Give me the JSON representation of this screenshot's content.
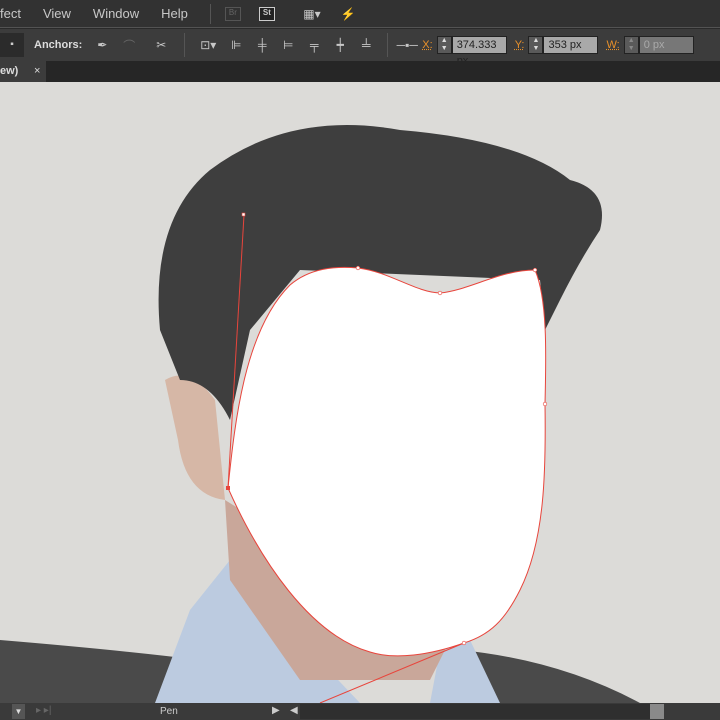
{
  "menu": [
    "fect",
    "View",
    "Window",
    "Help"
  ],
  "menu_icons": [
    "bridge-icon",
    "stock-icon",
    "workspace-icon",
    "sync-icon"
  ],
  "control": {
    "anchors_label": "Anchors:",
    "x_label": "X:",
    "x_value": "374.333 px",
    "y_label": "Y:",
    "y_value": "353 px",
    "w_label": "W:",
    "w_value": "0 px"
  },
  "tab": {
    "label": "ew)",
    "close": "×"
  },
  "status": {
    "tool": "Pen"
  },
  "colors": {
    "path": "#e8453c",
    "accent": "#e8902a"
  }
}
